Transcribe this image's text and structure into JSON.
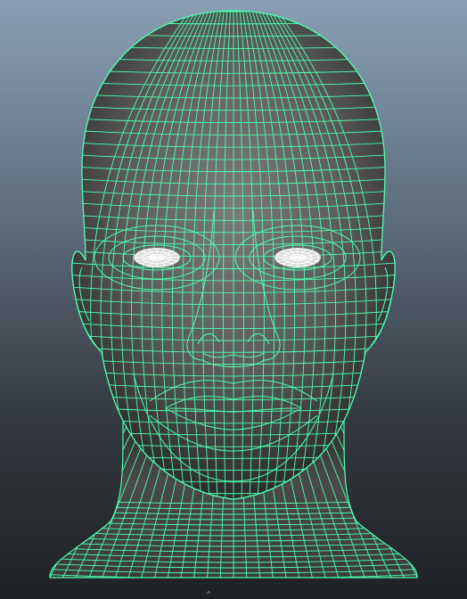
{
  "viewport": {
    "background_top": "#8a9fb4",
    "background_bottom": "#1f2225"
  },
  "model": {
    "object": "head-mesh",
    "display_mode": "wireframe-on-shaded",
    "wireframe_color": "#4dffb0",
    "shading_color": "#6b6b6b",
    "eye_highlight_color": "#ffffff"
  }
}
